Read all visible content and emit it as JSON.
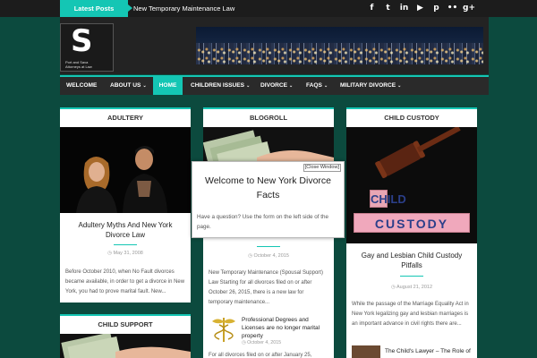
{
  "ticker": {
    "label": "Latest Posts",
    "headline": "New Temporary Maintenance Law"
  },
  "social": [
    {
      "icon": "facebook-icon",
      "glyph": "f"
    },
    {
      "icon": "twitter-icon",
      "glyph": "t"
    },
    {
      "icon": "linkedin-icon",
      "glyph": "in"
    },
    {
      "icon": "youtube-icon",
      "glyph": "▶"
    },
    {
      "icon": "pinterest-icon",
      "glyph": "p"
    },
    {
      "icon": "flickr-icon",
      "glyph": "••"
    },
    {
      "icon": "googleplus-icon",
      "glyph": "g+"
    }
  ],
  "logo": {
    "letter": "S",
    "line1": "Port and Sava",
    "line2": "Attorneys at Law"
  },
  "nav": {
    "items": [
      {
        "label": "WELCOME"
      },
      {
        "label": "ABOUT US"
      },
      {
        "label": "HOME"
      },
      {
        "label": "CHILDREN ISSUES"
      },
      {
        "label": "DIVORCE"
      },
      {
        "label": "FAQS"
      },
      {
        "label": "MILITARY DIVORCE"
      }
    ]
  },
  "colors": {
    "accent": "#14c6b4",
    "page_bg": "#0c4a3e",
    "header_bg": "#232323",
    "ticker_bg": "#1c1c1c"
  },
  "cards": {
    "adultery": {
      "title": "ADULTERY",
      "post_title": "Adultery Myths And New York Divorce Law",
      "date": "May 31, 2008",
      "excerpt": "Before October 2010, when No Fault divorces became available, in order to get a divorce in New York, you had to prove marital fault. New..."
    },
    "blogroll": {
      "title": "BLOGROLL",
      "date": "October 4, 2015",
      "excerpt": "New Temporary Maintenance (Spousal Support) Law Starting for all divorces filed on or after October 26, 2015, there is a new law for temporary maintenance...",
      "related_title": "Professional Degrees and Licenses are no longer marital property",
      "related_date": "October 4, 2015",
      "bottom_excerpt": "For all divorces filed on or after January 25,"
    },
    "child_custody": {
      "title": "CHILD CUSTODY",
      "post_title": "Gay and Lesbian Child Custody Pitfalls",
      "date": "August 21, 2012",
      "excerpt": "While the passage of the Marriage Equality Act in New York legalizing gay and lesbian marriages is an important advance in civil rights there are...",
      "related_title": "The Child's Lawyer – The Role of"
    },
    "child_support": {
      "title": "CHILD SUPPORT"
    }
  },
  "blocks": {
    "row1": "CHILD",
    "row2": "CUSTODY"
  },
  "modal": {
    "close_label": "[Close Window]",
    "title": "Welcome to New York Divorce Facts",
    "text": "Have a question? Use the form on the left side of the page."
  }
}
